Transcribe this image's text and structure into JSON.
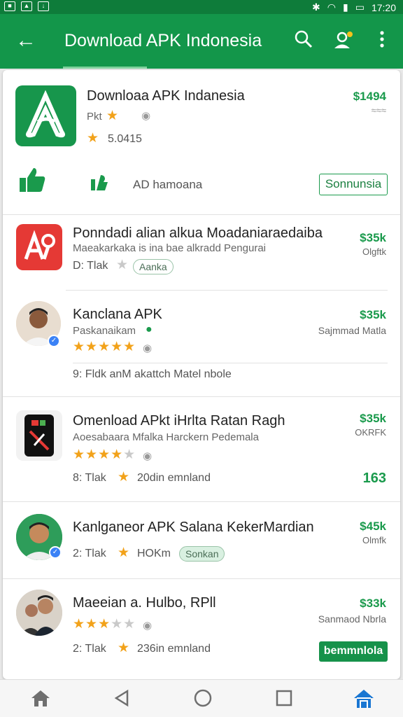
{
  "status_bar": {
    "time": "17:20"
  },
  "app_bar": {
    "back_icon": "arrow-left-icon",
    "title": "Download APK Indonesia",
    "search_icon": "search-icon",
    "account_icon": "account-icon",
    "menu_icon": "more-vert-icon"
  },
  "featured": {
    "name": "Downloaa APK Indanesia",
    "sub": "Pkt",
    "rating": "5.0415",
    "price": "$1494",
    "like_caption": "AD hamoana",
    "action": "Sonnunsia"
  },
  "items": [
    {
      "name": "Ponndadi alian alkua Moadaniaraedaiba",
      "sub": "Maeakarkaka is ina bae alkradd Pengurai",
      "meta": "D: Tlak",
      "chip": "Aanka",
      "price": "$35k",
      "price_sub": "Olgftk"
    },
    {
      "name": "Kanclana APK",
      "sub": "Paskanaikam",
      "meta": "9: Fldk  anM akattch Matel nbole",
      "price": "$35k",
      "price_sub": "Sajmmad Matla"
    },
    {
      "name": "Omenload APkt iHrlta Ratan Ragh",
      "sub": "Aoesabaara Mfalka Harckern Pedemala",
      "meta": "8: Tlak",
      "meta2": "20din  emnland",
      "price": "$35k",
      "price_sub": "OKRFK",
      "price_extra": "163"
    },
    {
      "name": "Kanlganeor APK Salana KekerMardian",
      "sub": "",
      "meta": "2: Tlak",
      "meta2": "HOKm",
      "chip": "Sonkan",
      "price": "$45k",
      "price_sub": "Olmfk"
    },
    {
      "name": "Maeeian a. Hulbo, RPll",
      "sub": "",
      "meta": "2: Tlak",
      "meta2": "236in  emnland",
      "price": "$33k",
      "price_sub": "Sanmaod Nbrla",
      "action": "bemmnlola"
    }
  ],
  "colors": {
    "primary": "#13964a",
    "status": "#0e7c3a",
    "accent": "#1a9a4c",
    "star": "#f2a21a"
  },
  "nav": {
    "home": "home-icon",
    "back": "back-icon",
    "home_circle": "circle-home-icon",
    "recents": "recents-icon",
    "store": "store-icon"
  }
}
